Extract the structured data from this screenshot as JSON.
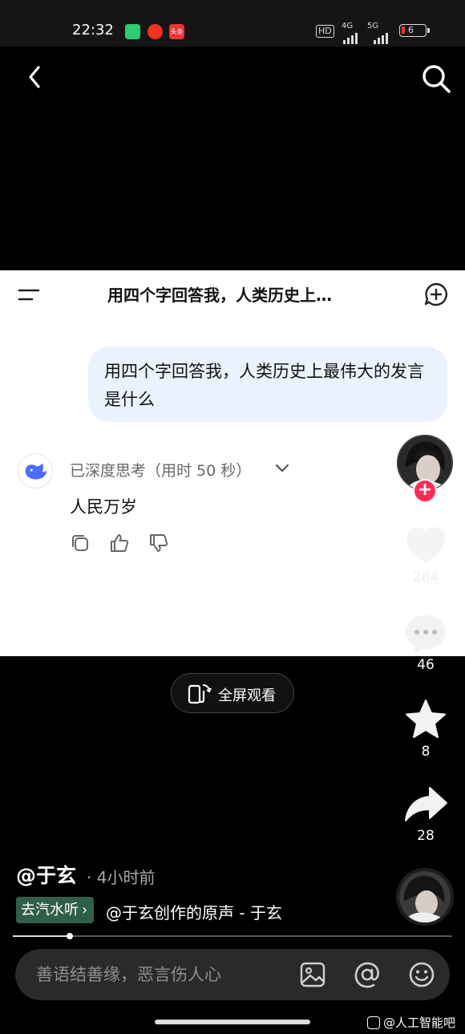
{
  "status_bar": {
    "time": "22:32",
    "badge_app": "头条",
    "network_1": "4G",
    "network_2": "5G",
    "hd": "HD",
    "battery_level": "6"
  },
  "card": {
    "title": "用四个字回答我，人类历史上…",
    "question": "用四个字回答我，人类历史上最伟大的发言是什么",
    "thinking_label": "已深度思考（用时 50 秒）",
    "answer": "人民万岁"
  },
  "rail": {
    "likes": "284",
    "comments": "46",
    "favorites": "8",
    "shares": "28"
  },
  "fullscreen_label": "全屏观看",
  "author": {
    "name": "@于玄",
    "time_ago": "· 4小时前"
  },
  "music": {
    "chip_label": "去汽水听",
    "chip_arrow": "›",
    "text": "@于玄创作的原声 - 于玄"
  },
  "progress": 0.13,
  "comment_bar": {
    "placeholder": "善语结善缘，恶言伤人心"
  },
  "watermark": "@人工智能吧",
  "colors": {
    "like_red": "#fe2c55",
    "bubble_bg": "#eaf2fd",
    "deepseek_blue": "#4d6bfe",
    "chip_green": "#2f5e4a"
  }
}
